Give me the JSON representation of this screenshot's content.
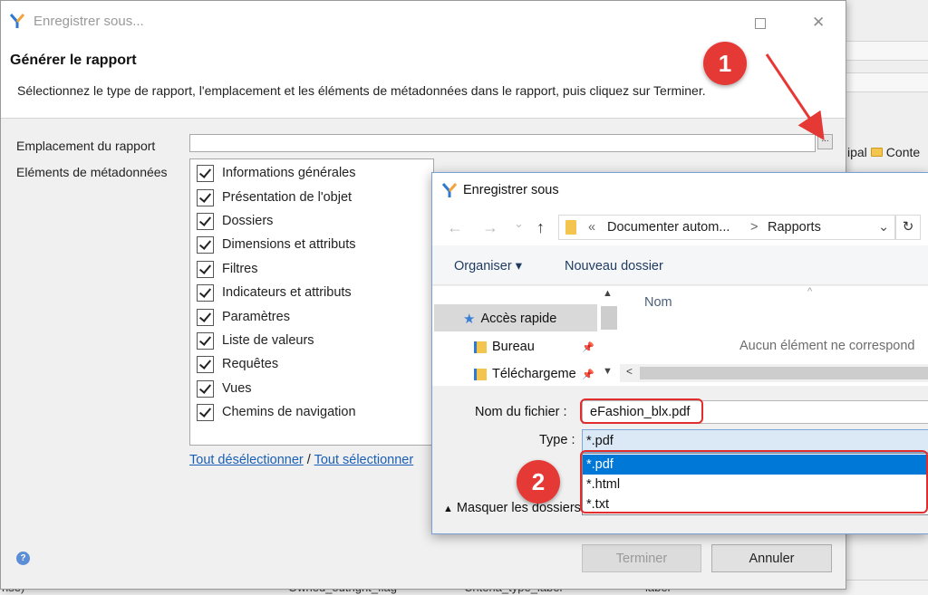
{
  "background": {
    "breadcrumb": [
      "ipal",
      "Conte"
    ],
    "bottom_texts": [
      "nse)",
      "Owned_outright_flag",
      "Criteria_type_label",
      "label"
    ]
  },
  "main_dialog": {
    "title": "Enregistrer sous...",
    "controls": {
      "maximize_icon": "maximize-icon",
      "close_icon": "close-icon",
      "close_glyph": "✕"
    },
    "header_title": "Générer le rapport",
    "header_description": "Sélectionnez le type de rapport, l'emplacement et les éléments de métadonnées dans le rapport, puis cliquez sur Terminer.",
    "location_label": "Emplacement du rapport",
    "location_value": "",
    "browse_label": "...",
    "metadata_label": "Eléments de métadonnées",
    "metadata_items": [
      {
        "label": "Informations générales",
        "checked": true
      },
      {
        "label": "Présentation de l'objet",
        "checked": true
      },
      {
        "label": "Dossiers",
        "checked": true
      },
      {
        "label": "Dimensions et attributs",
        "checked": true
      },
      {
        "label": "Filtres",
        "checked": true
      },
      {
        "label": "Indicateurs et attributs",
        "checked": true
      },
      {
        "label": "Paramètres",
        "checked": true
      },
      {
        "label": "Liste de valeurs",
        "checked": true
      },
      {
        "label": "Requêtes",
        "checked": true
      },
      {
        "label": "Vues",
        "checked": true
      },
      {
        "label": "Chemins de navigation",
        "checked": true
      }
    ],
    "deselect_all": "Tout désélectionner",
    "separator": " / ",
    "select_all": "Tout sélectionner",
    "help_glyph": "?",
    "finish_button": "Terminer",
    "cancel_button": "Annuler"
  },
  "save_dialog": {
    "title": "Enregistrer sous",
    "nav": {
      "back": "←",
      "forward": "→",
      "dropdown": "⌄",
      "up": "↑"
    },
    "address": {
      "prefix": "«",
      "path": [
        "Documenter autom...",
        "Rapports"
      ],
      "separator": ">",
      "dropdown": "⌄",
      "refresh": "↻"
    },
    "toolbar": {
      "organize": "Organiser ▾",
      "new_folder": "Nouveau dossier"
    },
    "nav_pane": [
      {
        "label": "Accès rapide",
        "icon": "star-icon"
      },
      {
        "label": "Bureau",
        "icon": "desktop-folder-icon"
      },
      {
        "label": "Téléchargeme",
        "icon": "downloads-folder-icon"
      }
    ],
    "column_name": "Nom",
    "empty_message": "Aucun élément ne correspond",
    "file_name_label": "Nom du fichier :",
    "file_name_value": "eFashion_blx.pdf",
    "type_label": "Type :",
    "type_value": "*.pdf",
    "type_options": [
      "*.pdf",
      "*.html",
      "*.txt"
    ],
    "selected_type_index": 0,
    "hide_folders": "Masquer les dossiers"
  },
  "annotations": {
    "callout_1": "1",
    "callout_2": "2",
    "color": "#e53935"
  }
}
